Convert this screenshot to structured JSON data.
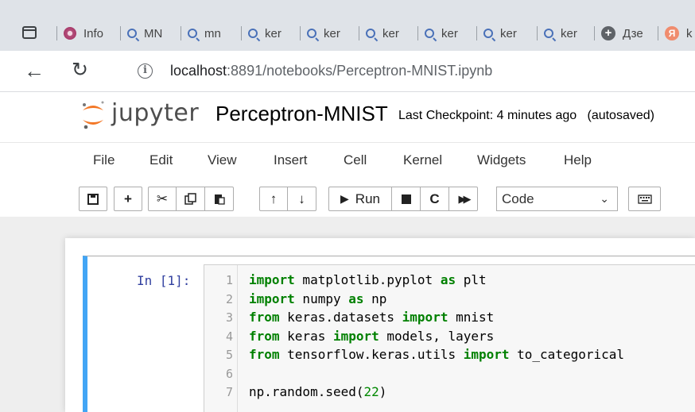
{
  "browser": {
    "tabs": [
      {
        "icon": "flower-icon",
        "label": "Info"
      },
      {
        "icon": "search-icon",
        "label": "MN"
      },
      {
        "icon": "search-icon",
        "label": "mn"
      },
      {
        "icon": "search-icon",
        "label": "ker"
      },
      {
        "icon": "search-icon",
        "label": "ker"
      },
      {
        "icon": "search-icon",
        "label": "ker"
      },
      {
        "icon": "search-icon",
        "label": "ker"
      },
      {
        "icon": "search-icon",
        "label": "ker"
      },
      {
        "icon": "search-icon",
        "label": "ker"
      },
      {
        "icon": "plus-circle-icon",
        "label": "Дзе"
      },
      {
        "icon": "yandex-icon",
        "label": "k"
      }
    ],
    "url_host": "localhost",
    "url_path": ":8891/notebooks/Perceptron-MNIST.ipynb"
  },
  "jupyter": {
    "logo_text": "jupyter",
    "notebook_name": "Perceptron-MNIST",
    "checkpoint": "Last Checkpoint: 4 minutes ago",
    "autosave": "(autosaved)",
    "menu": [
      "File",
      "Edit",
      "View",
      "Insert",
      "Cell",
      "Kernel",
      "Widgets",
      "Help"
    ],
    "toolbar": {
      "run_label": "Run",
      "cell_type": "Code"
    }
  },
  "cell": {
    "prompt": "In [1]:",
    "lines": [
      {
        "n": "1",
        "tokens": [
          {
            "t": "import",
            "k": "kw"
          },
          {
            "t": " matplotlib.pyplot "
          },
          {
            "t": "as",
            "k": "kw"
          },
          {
            "t": " plt"
          }
        ]
      },
      {
        "n": "2",
        "tokens": [
          {
            "t": "import",
            "k": "kw"
          },
          {
            "t": " numpy "
          },
          {
            "t": "as",
            "k": "kw"
          },
          {
            "t": " np"
          }
        ]
      },
      {
        "n": "3",
        "tokens": [
          {
            "t": "from",
            "k": "kw"
          },
          {
            "t": " keras.datasets "
          },
          {
            "t": "import",
            "k": "kw"
          },
          {
            "t": " mnist"
          }
        ]
      },
      {
        "n": "4",
        "tokens": [
          {
            "t": "from",
            "k": "kw"
          },
          {
            "t": " keras "
          },
          {
            "t": "import",
            "k": "kw"
          },
          {
            "t": " models, layers"
          }
        ]
      },
      {
        "n": "5",
        "tokens": [
          {
            "t": "from",
            "k": "kw"
          },
          {
            "t": " tensorflow.keras.utils "
          },
          {
            "t": "import",
            "k": "kw"
          },
          {
            "t": " to_categorical"
          }
        ]
      },
      {
        "n": "6",
        "tokens": []
      },
      {
        "n": "7",
        "tokens": [
          {
            "t": "np.random.seed("
          },
          {
            "t": "22",
            "k": "num"
          },
          {
            "t": ")"
          }
        ]
      }
    ]
  }
}
